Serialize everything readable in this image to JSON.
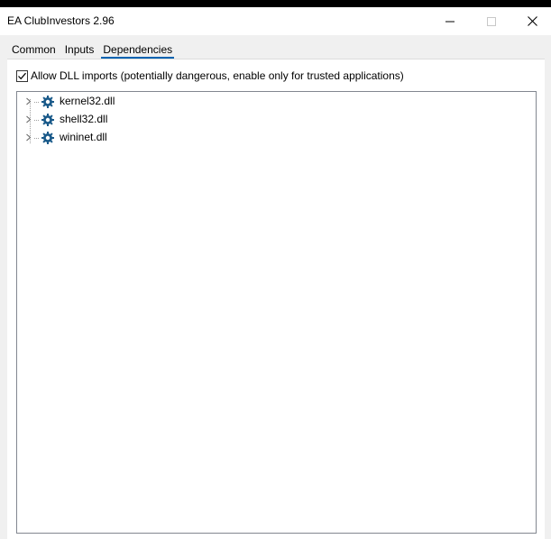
{
  "window": {
    "title": "EA ClubInvestors 2.96"
  },
  "tabs": [
    {
      "label": "Common",
      "active": false
    },
    {
      "label": "Inputs",
      "active": false
    },
    {
      "label": "Dependencies",
      "active": true
    }
  ],
  "dependencies": {
    "allow_dll_label": "Allow DLL imports (potentially dangerous, enable only for trusted applications)",
    "allow_dll_checked": true,
    "items": [
      {
        "label": "kernel32.dll",
        "icon": "gear-icon"
      },
      {
        "label": "shell32.dll",
        "icon": "gear-icon"
      },
      {
        "label": "wininet.dll",
        "icon": "gear-icon"
      }
    ]
  },
  "colors": {
    "accent": "#0063b1",
    "gear_icon": "#1a5a8a"
  }
}
